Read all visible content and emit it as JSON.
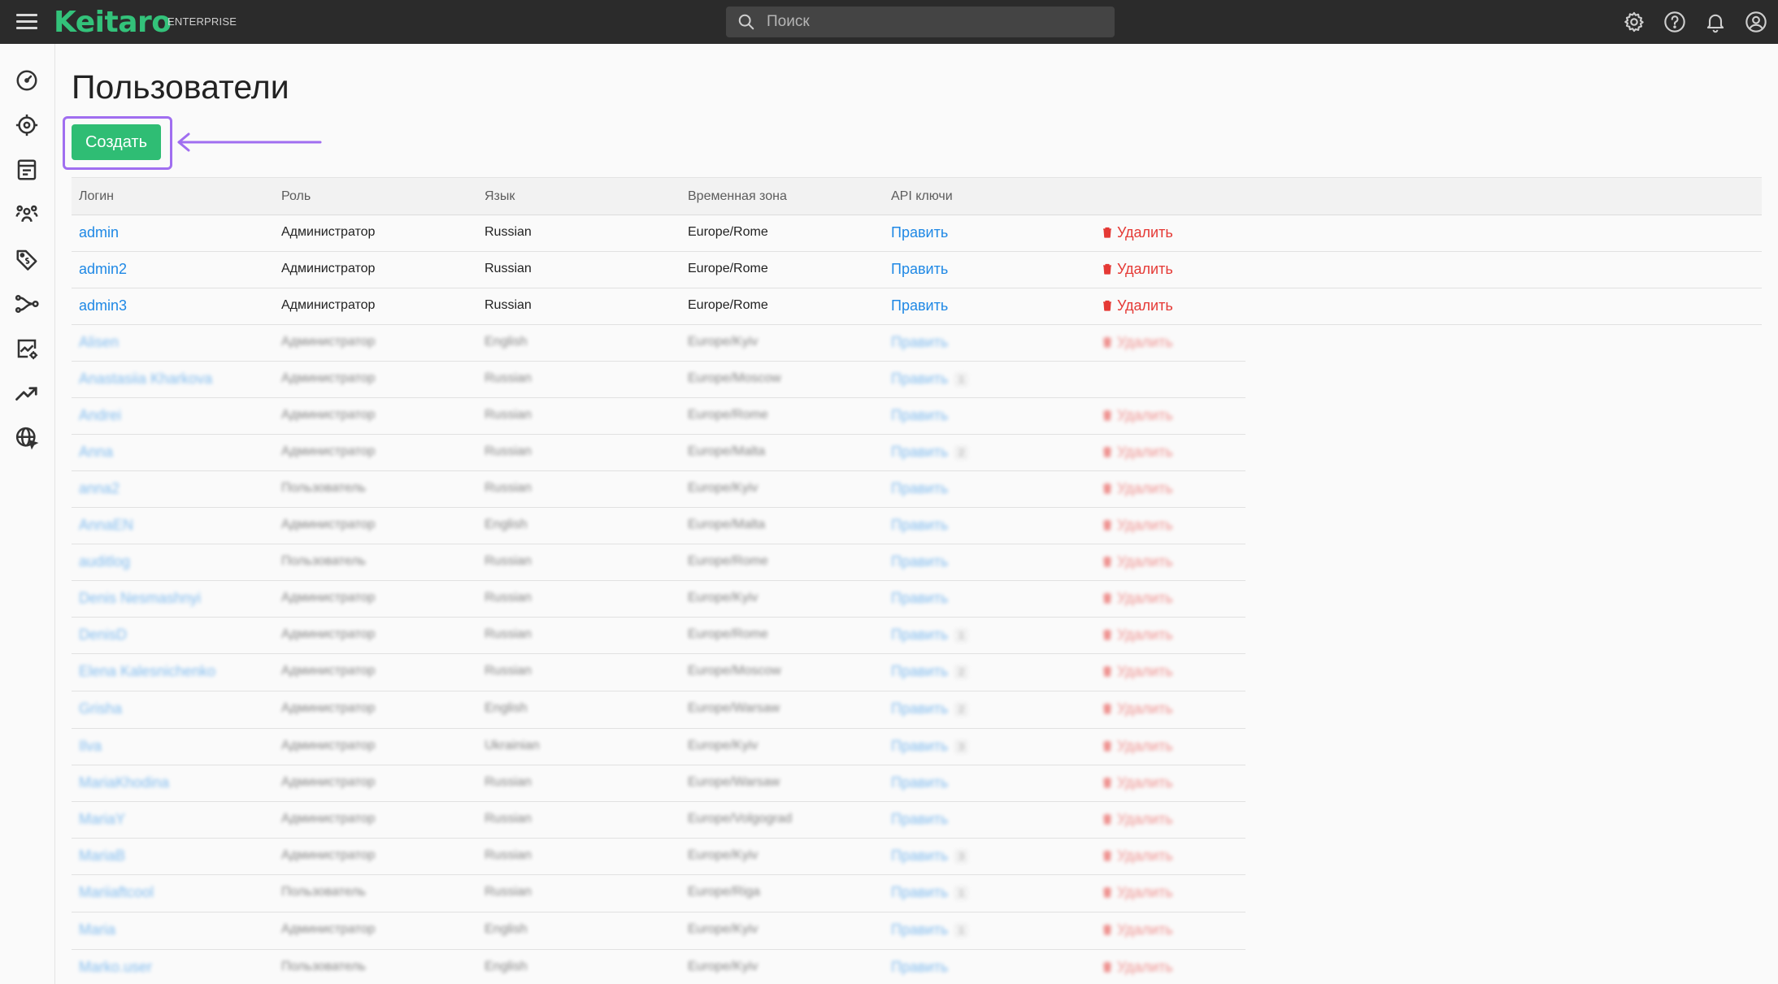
{
  "app": {
    "logo": "Keitaro",
    "edition": "ENTERPRISE"
  },
  "search": {
    "placeholder": "Поиск"
  },
  "topbar_icons": [
    "settings-icon",
    "help-icon",
    "bell-icon",
    "account-icon"
  ],
  "sidebar_icons": [
    "dashboard-icon",
    "campaigns-icon",
    "landings-icon",
    "users-icon",
    "offers-icon",
    "flows-icon",
    "reports-icon",
    "trends-icon",
    "geo-icon"
  ],
  "page": {
    "title": "Пользователи",
    "create_label": "Создать"
  },
  "table": {
    "columns": {
      "login": "Логин",
      "role": "Роль",
      "language": "Язык",
      "timezone": "Временная зона",
      "api_keys": "API ключи"
    },
    "edit_label": "Править",
    "delete_label": "Удалить",
    "rows": [
      {
        "login": "admin",
        "role": "Администратор",
        "language": "Russian",
        "timezone": "Europe/Rome",
        "api_count": "",
        "delete": true
      },
      {
        "login": "admin2",
        "role": "Администратор",
        "language": "Russian",
        "timezone": "Europe/Rome",
        "api_count": "",
        "delete": true
      },
      {
        "login": "admin3",
        "role": "Администратор",
        "language": "Russian",
        "timezone": "Europe/Rome",
        "api_count": "",
        "delete": true
      },
      {
        "login": "Alisen",
        "role": "Администратор",
        "language": "English",
        "timezone": "Europe/Kyiv",
        "api_count": "",
        "delete": true
      },
      {
        "login": "Anastasiia Kharkova",
        "role": "Администратор",
        "language": "Russian",
        "timezone": "Europe/Moscow",
        "api_count": "1",
        "delete": false
      },
      {
        "login": "Andrei",
        "role": "Администратор",
        "language": "Russian",
        "timezone": "Europe/Rome",
        "api_count": "",
        "delete": true
      },
      {
        "login": "Anna",
        "role": "Администратор",
        "language": "Russian",
        "timezone": "Europe/Malta",
        "api_count": "2",
        "delete": true
      },
      {
        "login": "anna2",
        "role": "Пользователь",
        "language": "Russian",
        "timezone": "Europe/Kyiv",
        "api_count": "",
        "delete": true
      },
      {
        "login": "AnnaEN",
        "role": "Администратор",
        "language": "English",
        "timezone": "Europe/Malta",
        "api_count": "",
        "delete": true
      },
      {
        "login": "auditlog",
        "role": "Пользователь",
        "language": "Russian",
        "timezone": "Europe/Rome",
        "api_count": "",
        "delete": true
      },
      {
        "login": "Denis Nesmashnyi",
        "role": "Администратор",
        "language": "Russian",
        "timezone": "Europe/Kyiv",
        "api_count": "",
        "delete": true
      },
      {
        "login": "DenisD",
        "role": "Администратор",
        "language": "Russian",
        "timezone": "Europe/Rome",
        "api_count": "1",
        "delete": true
      },
      {
        "login": "Elena Kalesnichenko",
        "role": "Администратор",
        "language": "Russian",
        "timezone": "Europe/Moscow",
        "api_count": "2",
        "delete": true
      },
      {
        "login": "Grisha",
        "role": "Администратор",
        "language": "English",
        "timezone": "Europe/Warsaw",
        "api_count": "2",
        "delete": true
      },
      {
        "login": "Ilva",
        "role": "Администратор",
        "language": "Ukrainian",
        "timezone": "Europe/Kyiv",
        "api_count": "3",
        "delete": true
      },
      {
        "login": "MariaKhodina",
        "role": "Администратор",
        "language": "Russian",
        "timezone": "Europe/Warsaw",
        "api_count": "",
        "delete": true
      },
      {
        "login": "MariaY",
        "role": "Администратор",
        "language": "Russian",
        "timezone": "Europe/Volgograd",
        "api_count": "",
        "delete": true
      },
      {
        "login": "MariaB",
        "role": "Администратор",
        "language": "Russian",
        "timezone": "Europe/Kyiv",
        "api_count": "3",
        "delete": true
      },
      {
        "login": "Mariiaftcool",
        "role": "Пользователь",
        "language": "Russian",
        "timezone": "Europe/Riga",
        "api_count": "1",
        "delete": true
      },
      {
        "login": "Maria",
        "role": "Администратор",
        "language": "English",
        "timezone": "Europe/Kyiv",
        "api_count": "1",
        "delete": true
      },
      {
        "login": "Marko.user",
        "role": "Пользователь",
        "language": "English",
        "timezone": "Europe/Kyiv",
        "api_count": "",
        "delete": true
      }
    ]
  }
}
